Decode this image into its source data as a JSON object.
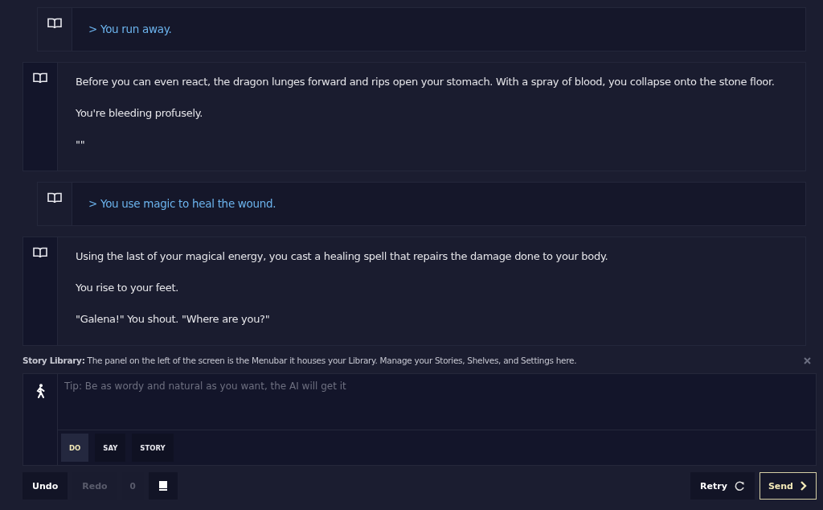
{
  "entries": [
    {
      "kind": "action",
      "paragraphs": [
        "> You run away."
      ]
    },
    {
      "kind": "story",
      "paragraphs": [
        "Before you can even react, the dragon lunges forward and rips open your stomach. With a spray of blood, you collapse onto the stone floor.",
        "You're bleeding profusely.",
        "\"\""
      ]
    },
    {
      "kind": "action",
      "paragraphs": [
        "> You use magic to heal the wound."
      ]
    },
    {
      "kind": "story",
      "paragraphs": [
        "Using the last of your magical energy, you cast a healing spell that repairs the damage done to your body.",
        "You rise to your feet.",
        "\"Galena!\" You shout. \"Where are you?\""
      ]
    }
  ],
  "tip": {
    "title": "Story Library:",
    "text": "The panel on the left of the screen is the Menubar it houses your Library. Manage your Stories, Shelves, and Settings here."
  },
  "input": {
    "placeholder": "Tip: Be as wordy and natural as you want, the AI will get it"
  },
  "modes": [
    {
      "label": "DO",
      "selected": true
    },
    {
      "label": "SAY",
      "selected": false
    },
    {
      "label": "STORY",
      "selected": false
    }
  ],
  "controls": {
    "undo": "Undo",
    "redo": "Redo",
    "redo_disabled": true,
    "count": "0",
    "retry": "Retry",
    "send": "Send"
  }
}
